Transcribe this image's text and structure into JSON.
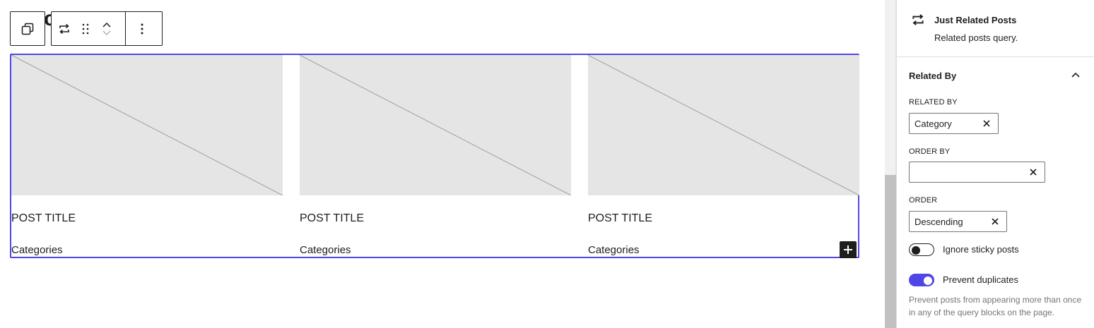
{
  "canvas": {
    "toolbar": {
      "icons": [
        "duplicate-icon",
        "query-loop-icon",
        "drag-handle-icon",
        "move-up-icon",
        "move-down-icon",
        "more-options-icon"
      ]
    },
    "posts": [
      {
        "title": "POST TITLE",
        "categories": "Categories"
      },
      {
        "title": "POST TITLE",
        "categories": "Categories"
      },
      {
        "title": "POST TITLE",
        "categories": "Categories"
      }
    ],
    "accent_color": "#4f46e5",
    "placeholder_bg": "#e5e5e5"
  },
  "sidebar": {
    "block_card": {
      "title": "Just Related Posts",
      "description": "Related posts query."
    },
    "panel": {
      "title": "Related By",
      "expanded": true,
      "related_by": {
        "label": "RELATED BY",
        "value": "Category"
      },
      "order_by": {
        "label": "ORDER BY",
        "value": ""
      },
      "order": {
        "label": "ORDER",
        "value": "Descending"
      },
      "ignore_sticky": {
        "label": "Ignore sticky posts",
        "checked": false
      },
      "prevent_duplicates": {
        "label": "Prevent duplicates",
        "checked": true
      },
      "help_text": "Prevent posts from appearing more than once in any of the query blocks on the page."
    }
  }
}
